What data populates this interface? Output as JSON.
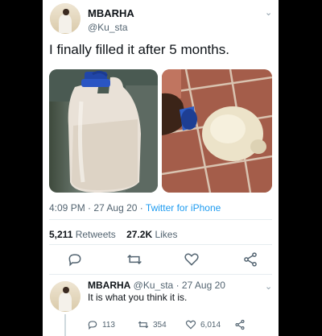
{
  "tweet": {
    "display_name": "MBARHA",
    "handle": "@Ku_sta",
    "text": "I finally filled it after 5 months.",
    "time": "4:09 PM",
    "date": "27 Aug 20",
    "source": "Twitter for iPhone",
    "retweets_count": "5,211",
    "retweets_label": "Retweets",
    "likes_count": "27.2K",
    "likes_label": "Likes"
  },
  "reply": {
    "display_name": "MBARHA",
    "handle": "@Ku_sta",
    "date": "27 Aug 20",
    "text": "It is what you think it is.",
    "replies": "113",
    "retweets": "354",
    "likes": "6,014"
  },
  "icons": {
    "reply": "reply-icon",
    "retweet": "retweet-icon",
    "like": "heart-icon",
    "share": "share-icon",
    "more": "chevron-down-icon"
  },
  "colors": {
    "link": "#1d9bf0",
    "muted": "#536471",
    "background": "#000000"
  }
}
